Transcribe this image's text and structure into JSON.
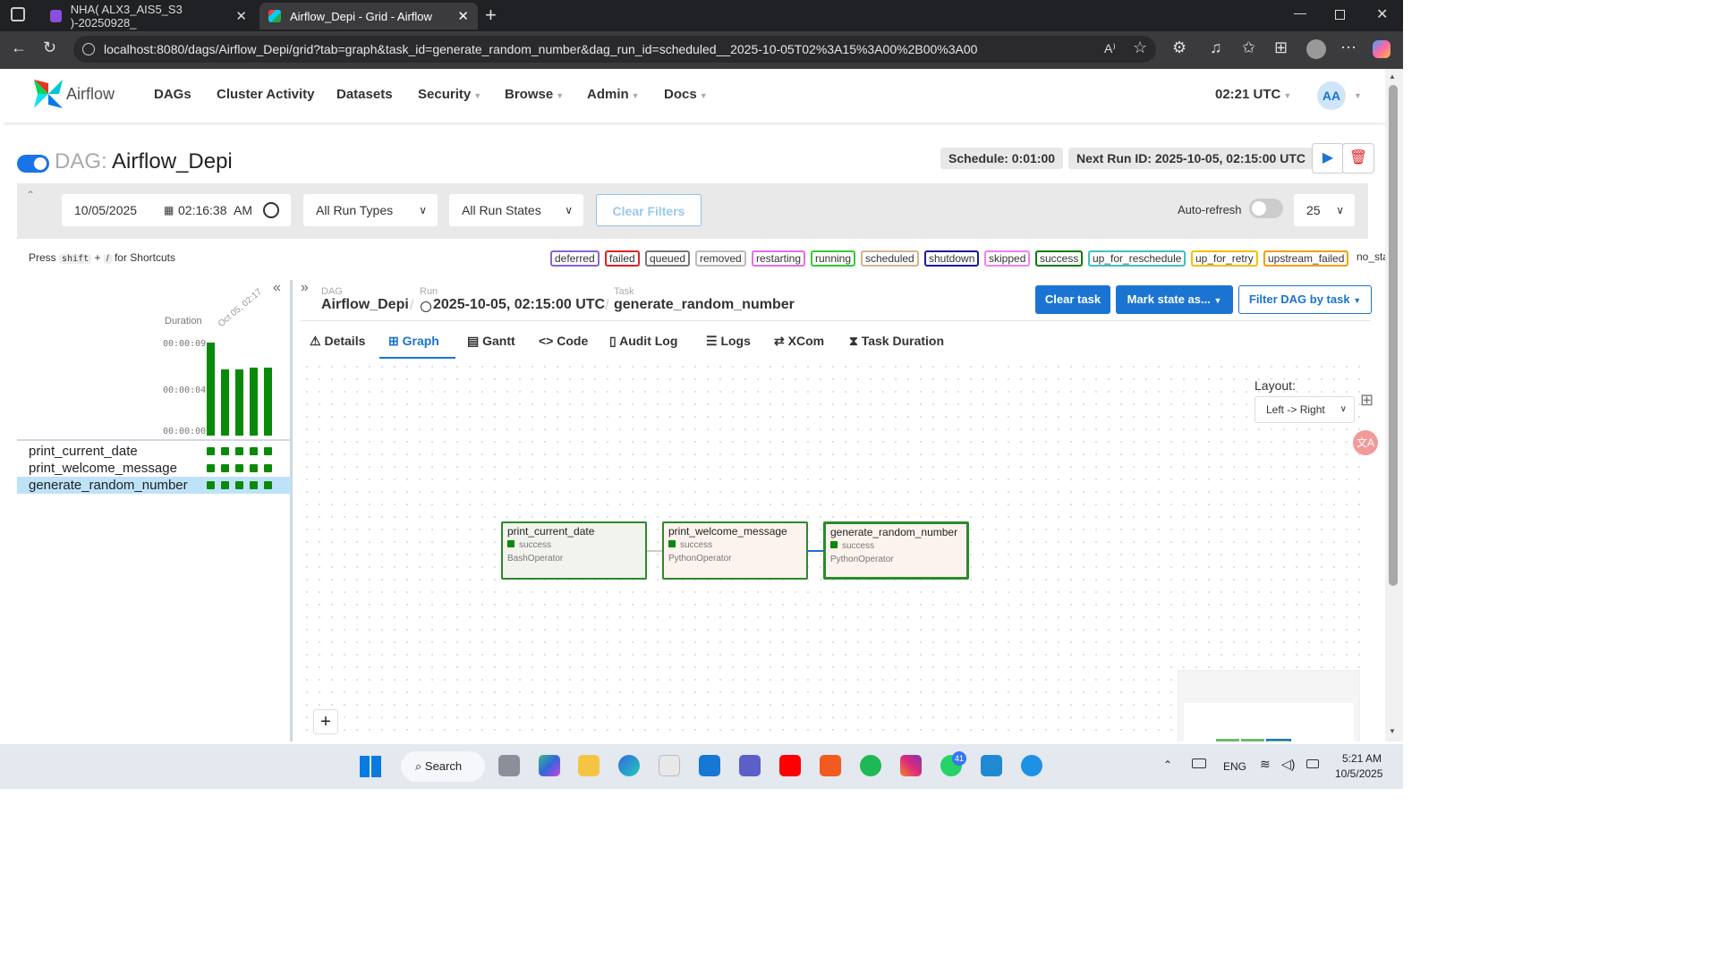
{
  "browser": {
    "tabs": [
      {
        "title": "NHA( ALX3_AIS5_S3 )-20250928_"
      },
      {
        "title": "Airflow_Depi - Grid - Airflow"
      }
    ],
    "url": "localhost:8080/dags/Airflow_Depi/grid?tab=graph&task_id=generate_random_number&dag_run_id=scheduled__2025-10-05T02%3A15%3A00%2B00%3A00"
  },
  "navbar": {
    "brand": "Airflow",
    "items": [
      "DAGs",
      "Cluster Activity",
      "Datasets",
      "Security",
      "Browse",
      "Admin",
      "Docs"
    ],
    "time": "02:21 UTC",
    "avatar": "AA"
  },
  "dag": {
    "prefix": "DAG:",
    "name": "Airflow_Depi",
    "schedule": "Schedule: 0:01:00",
    "next_run": "Next Run ID: 2025-10-05, 02:15:00 UTC"
  },
  "filters": {
    "date": "10/05/2025",
    "time": "02:16:38",
    "ampm": "AM",
    "run_types": "All Run Types",
    "run_states": "All Run States",
    "clear": "Clear Filters",
    "autorefresh": "Auto-refresh",
    "page_size": "25"
  },
  "shortcuts": {
    "press": "Press",
    "shift": "shift",
    "plus": "+",
    "slash": "/",
    "suffix": "for Shortcuts"
  },
  "legend": [
    {
      "label": "deferred",
      "color": "#8a63d2"
    },
    {
      "label": "failed",
      "color": "#e02020"
    },
    {
      "label": "queued",
      "color": "#777777"
    },
    {
      "label": "removed",
      "color": "#bbbbbb"
    },
    {
      "label": "restarting",
      "color": "#e070e0"
    },
    {
      "label": "running",
      "color": "#33cc33"
    },
    {
      "label": "scheduled",
      "color": "#d2b48c"
    },
    {
      "label": "shutdown",
      "color": "#1a1aa0"
    },
    {
      "label": "skipped",
      "color": "#f080f0"
    },
    {
      "label": "success",
      "color": "#0a7a0a"
    },
    {
      "label": "up_for_reschedule",
      "color": "#40c0c0"
    },
    {
      "label": "up_for_retry",
      "color": "#f0c000"
    },
    {
      "label": "upstream_failed",
      "color": "#f0a000"
    },
    {
      "label": "no_status",
      "color": "transparent"
    }
  ],
  "grid": {
    "duration_label": "Duration",
    "run_label": "Oct 05, 02:17",
    "y_ticks": [
      "00:00:09",
      "00:00:04",
      "00:00:00"
    ],
    "durations_sec": [
      9,
      6.4,
      6.4,
      6.6,
      6.6
    ],
    "tasks": [
      "print_current_date",
      "print_welcome_message",
      "generate_random_number"
    ]
  },
  "breadcrumb": {
    "dag_label": "DAG",
    "dag": "Airflow_Depi",
    "run_label": "Run",
    "run": "2025-10-05, 02:15:00 UTC",
    "task_label": "Task",
    "task": "generate_random_number"
  },
  "actions": {
    "clear_task": "Clear task",
    "mark_state": "Mark state as...",
    "filter_dag": "Filter DAG by task"
  },
  "tabs": [
    "Details",
    "Graph",
    "Gantt",
    "Code",
    "Audit Log",
    "Logs",
    "XCom",
    "Task Duration"
  ],
  "layout": {
    "label": "Layout:",
    "value": "Left -> Right"
  },
  "nodes": [
    {
      "name": "print_current_date",
      "state": "success",
      "operator": "BashOperator"
    },
    {
      "name": "print_welcome_message",
      "state": "success",
      "operator": "PythonOperator"
    },
    {
      "name": "generate_random_number",
      "state": "success",
      "operator": "PythonOperator"
    }
  ],
  "taskbar": {
    "search": "Search",
    "lang": "ENG",
    "time": "5:21 AM",
    "date": "10/5/2025",
    "badge": "41"
  }
}
